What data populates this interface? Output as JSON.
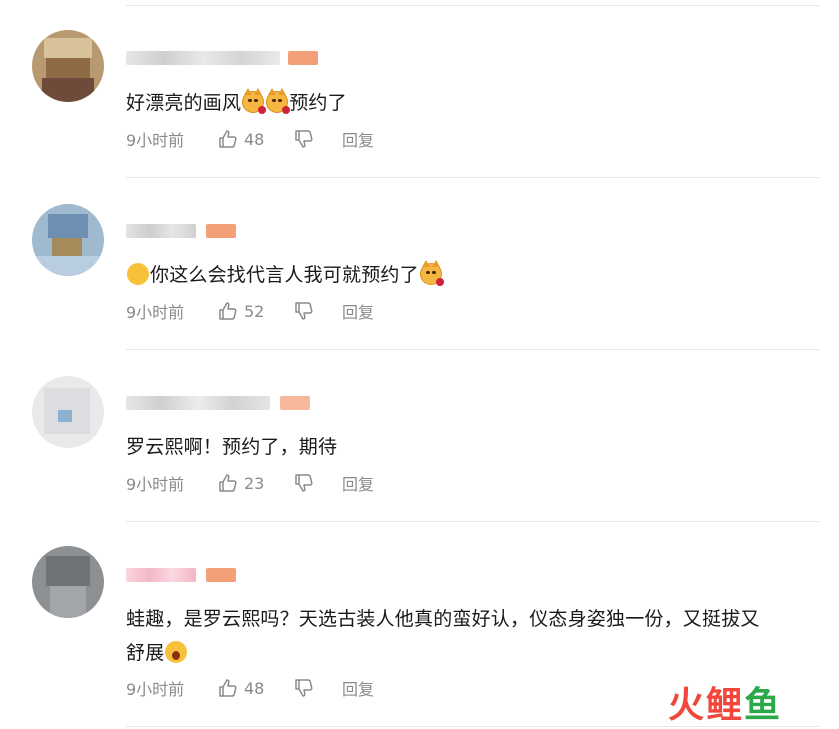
{
  "comments": [
    {
      "text": "好漂亮的画风",
      "suffix": "预约了",
      "time": "9小时前",
      "likes": "48",
      "reply": "回复"
    },
    {
      "text": "你这么会找代言人我可就预约了",
      "time": "9小时前",
      "likes": "52",
      "reply": "回复"
    },
    {
      "text": "罗云熙啊！预约了，期待",
      "time": "9小时前",
      "likes": "23",
      "reply": "回复"
    },
    {
      "text": "蛙趣，是罗云熙吗？天选古装人他真的蛮好认，仪态身姿独一份，又挺拔又",
      "line2": "舒展",
      "time": "9小时前",
      "likes": "48",
      "reply": "回复"
    }
  ],
  "watermark": {
    "part1": "火",
    "part2": "鲤",
    "part3": "鱼"
  },
  "icons": [
    "thumbs-up-icon",
    "thumbs-down-icon",
    "cat-rose-emoji",
    "smile-cat-emoji",
    "scream-emoji"
  ],
  "colors": {
    "meta_text": "#8a8a8a",
    "badge": "#f3a07a",
    "logo_red": "#f0473a",
    "logo_green": "#2aa84a"
  }
}
